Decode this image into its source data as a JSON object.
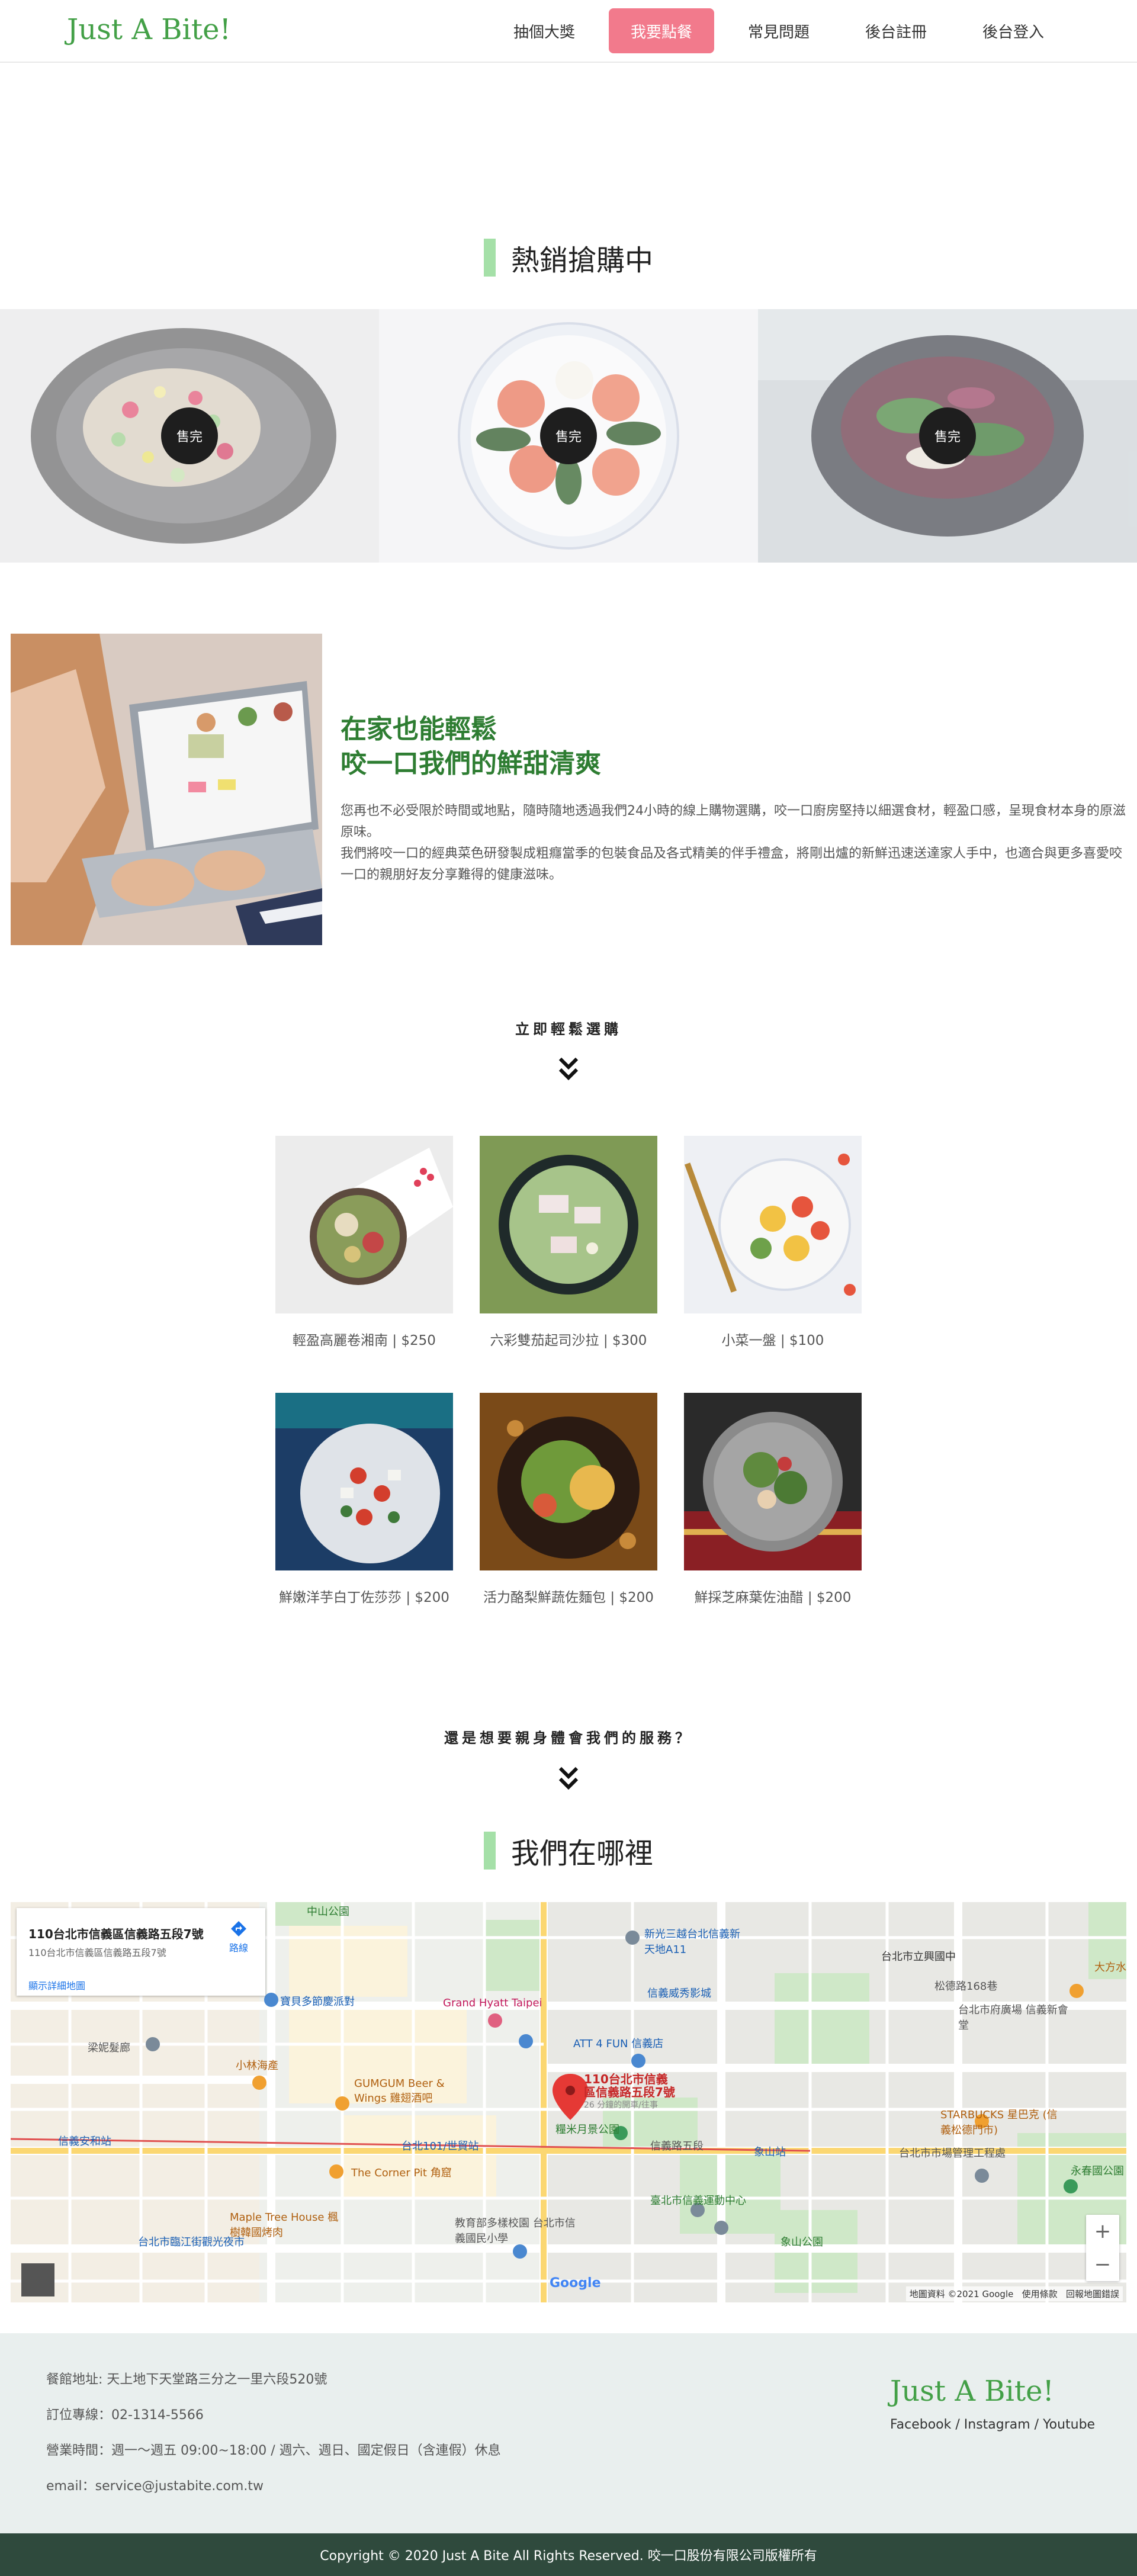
{
  "nav": {
    "logo": "Just A Bite!",
    "links": [
      "抽個大獎",
      "我要點餐",
      "常見問題",
      "後台註冊",
      "後台登入"
    ],
    "active_index": 1
  },
  "hot": {
    "title": "熱銷搶購中",
    "sold_label": "售完",
    "items": 3
  },
  "about": {
    "heading_line1": "在家也能輕鬆",
    "heading_line2": "咬一口我們的鮮甜清爽",
    "para1": "您再也不必受限於時間或地點，隨時隨地透過我們24小時的線上購物選購，咬一口廚房堅持以細選食材，輕盈口感，呈現食材本身的原滋原味。",
    "para2": "我們將咬一口的經典菜色研發製成粗癮當季的包裝食品及各式精美的伴手禮盒，將剛出爐的新鮮迅速送達家人手中，也適合與更多喜愛咬一口的親朋好友分享難得的健康滋味。"
  },
  "cta1": "立即輕鬆選購",
  "products": [
    {
      "name": "輕盈高麗卷湘南",
      "price": "$250"
    },
    {
      "name": "六彩雙茄起司沙拉",
      "price": "$300"
    },
    {
      "name": "小菜一盤",
      "price": "$100"
    },
    {
      "name": "鮮嫩洋芋白丁佐莎莎",
      "price": "$200"
    },
    {
      "name": "活力酪梨鮮蔬佐麵包",
      "price": "$200"
    },
    {
      "name": "鮮採芝麻葉佐油醋",
      "price": "$200"
    }
  ],
  "cta2": "還是想要親身體會我們的服務？",
  "where": {
    "title": "我們在哪裡"
  },
  "map": {
    "address_title": "110台北市信義區信義路五段7號",
    "address_sub": "110台北市信義區信義路五段7號",
    "larger_map": "顯示詳細地圖",
    "directions": "路線",
    "pin_label_1": "110台北市信義",
    "pin_label_2": "區信義路五段7號",
    "pin_sub": "26 分鐘的開車/往事",
    "attribution": "地圖資料 ©2021 Google",
    "terms": "使用條款",
    "report": "回報地圖錯誤",
    "google": "Google",
    "labels": [
      "中山公園",
      "台北市立興國中",
      "新光三越台北信義新天地A11",
      "信義威秀影城",
      "Grand Hyatt Taipei",
      "ATT 4 FUN 信義店",
      "梁妮髮廊",
      "小林海產",
      "GUMGUM Beer & Wings 雞翅酒吧",
      "台北101/世貿站",
      "信義安和站",
      "象山站",
      "The Corner Pit 角窟",
      "Maple Tree House 楓樹韓國烤肉",
      "臺北市信義運動中心",
      "教育部多樣校園 台北市信義國民小學",
      "STARBUCKS 星巴克 (信義松德門市)",
      "台北市市場管理工程處",
      "永春國公園",
      "象山公園",
      "台北市臨江街觀光夜市",
      "糧米月景公園",
      "信義路五段",
      "松德路168巷",
      "台北市府廣場 信義新會堂",
      "大方水",
      "寶貝多節慶派對"
    ]
  },
  "footer": {
    "address": "餐館地址: 天上地下天堂路三分之一里六段520號",
    "phone": "訂位專線：02-1314-5566",
    "hours": "營業時間：週一～週五 09:00~18:00 / 週六、週日、國定假日（含連假）休息",
    "email": "email：service@justabite.com.tw",
    "logo": "Just A Bite!",
    "social": "Facebook / Instagram / Youtube",
    "copyright": "Copyright © 2020 Just A Bite All Rights Reserved. 咬一口股份有限公司版權所有"
  },
  "colors": {
    "brand_green": "#43a047",
    "nav_active": "#f27a8c",
    "section_bar": "#a5e0a8",
    "footer_bg": "#e9efee",
    "copyright_bg": "#2f4a3d"
  }
}
